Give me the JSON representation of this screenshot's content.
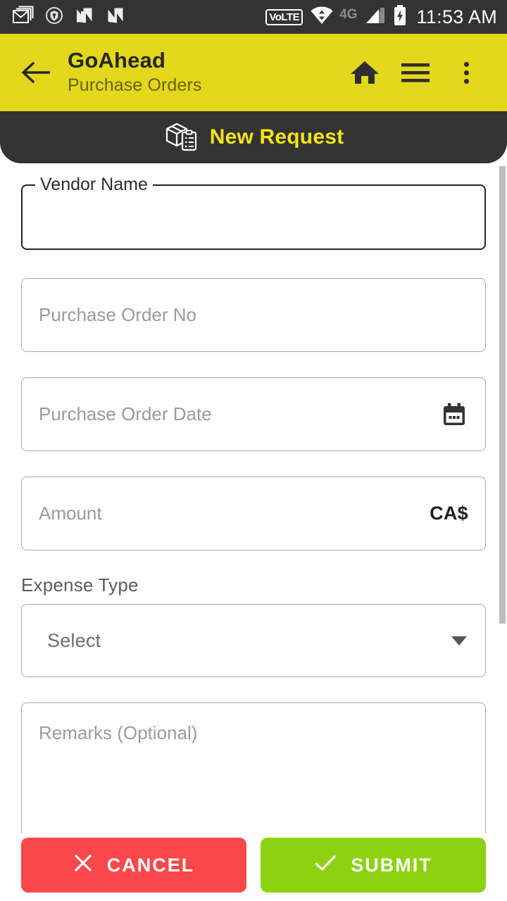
{
  "status_bar": {
    "time": "11:53 AM",
    "network_label": "4G",
    "volte_label": "VoLTE",
    "left_icons": [
      "gmail-icon",
      "shield-key-icon",
      "nova-launcher-icon",
      "nova-launcher-icon"
    ],
    "right_icons": [
      "volte-icon",
      "wifi-icon",
      "signal-icon",
      "battery-charging-icon"
    ],
    "background": "#333333"
  },
  "app_bar": {
    "back_label": "Back",
    "title": "GoAhead",
    "subtitle": "Purchase Orders",
    "background": "#e3d81c",
    "actions": [
      {
        "name": "home-icon",
        "label": "Home"
      },
      {
        "name": "hamburger-menu-icon",
        "label": "Menu"
      },
      {
        "name": "overflow-menu-icon",
        "label": "More options"
      }
    ]
  },
  "banner": {
    "title": "New Request",
    "icon": "package-clipboard-icon",
    "background": "#333333",
    "title_color": "#f2e516"
  },
  "form": {
    "vendor_name": {
      "label": "Vendor Name",
      "value": "",
      "placeholder": "",
      "focused": true
    },
    "purchase_order_no": {
      "placeholder": "Purchase Order No",
      "value": ""
    },
    "purchase_order_date": {
      "placeholder": "Purchase Order Date",
      "value": "",
      "suffix_icon": "calendar-icon"
    },
    "amount": {
      "placeholder": "Amount",
      "value": "",
      "currency": "CA$"
    },
    "expense_type": {
      "label": "Expense Type",
      "selected": "Select",
      "options": [
        "Select"
      ]
    },
    "remarks": {
      "placeholder": "Remarks (Optional)",
      "value": ""
    }
  },
  "actions": {
    "cancel_label": "CANCEL",
    "cancel_icon": "close-icon",
    "cancel_color": "#f9484a",
    "submit_label": "SUBMIT",
    "submit_icon": "check-icon",
    "submit_color": "#8cd211"
  },
  "scroll": {
    "position": "top"
  }
}
